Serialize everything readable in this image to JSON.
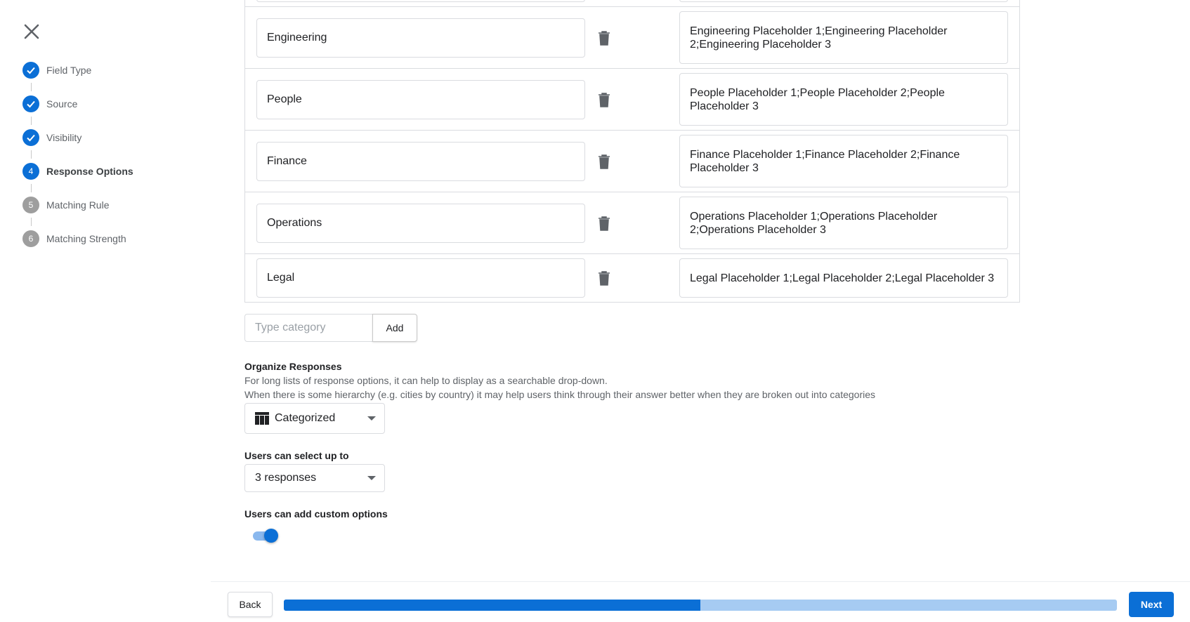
{
  "sidebar": {
    "close_icon": "close-x-icon",
    "steps": [
      {
        "number": "1",
        "label": "Field Type",
        "state": "done"
      },
      {
        "number": "2",
        "label": "Source",
        "state": "done"
      },
      {
        "number": "3",
        "label": "Visibility",
        "state": "done"
      },
      {
        "number": "4",
        "label": "Response Options",
        "state": "active"
      },
      {
        "number": "5",
        "label": "Matching Rule",
        "state": "todo"
      },
      {
        "number": "6",
        "label": "Matching Strength",
        "state": "todo"
      }
    ]
  },
  "categories": [
    {
      "name": "Engineering",
      "options": "Engineering Placeholder 1;Engineering Placeholder 2;Engineering Placeholder 3"
    },
    {
      "name": "People",
      "options": "People Placeholder 1;People Placeholder 2;People Placeholder 3"
    },
    {
      "name": "Finance",
      "options": "Finance Placeholder 1;Finance Placeholder 2;Finance Placeholder 3"
    },
    {
      "name": "Operations",
      "options": "Operations Placeholder 1;Operations Placeholder 2;Operations Placeholder 3"
    },
    {
      "name": "Legal",
      "options": "Legal Placeholder 1;Legal Placeholder 2;Legal Placeholder 3"
    }
  ],
  "add_category": {
    "placeholder": "Type category",
    "button_label": "Add"
  },
  "organize": {
    "title": "Organize Responses",
    "desc_line1": "For long lists of response options, it can help to display as a searchable drop-down.",
    "desc_line2": "When there is some hierarchy (e.g. cities by country) it may help users think through their answer better when they are broken out into categories",
    "selected": "Categorized",
    "icon": "table-grid-icon"
  },
  "select_limit": {
    "title": "Users can select up to",
    "selected": "3 responses"
  },
  "custom_options": {
    "title": "Users can add custom options",
    "enabled": true
  },
  "footer": {
    "back_label": "Back",
    "next_label": "Next",
    "progress_fraction": 0.5
  },
  "colors": {
    "accent": "#0b6fd6",
    "progress_track": "#a6cbf2",
    "inactive_step": "#9e9e9e"
  }
}
